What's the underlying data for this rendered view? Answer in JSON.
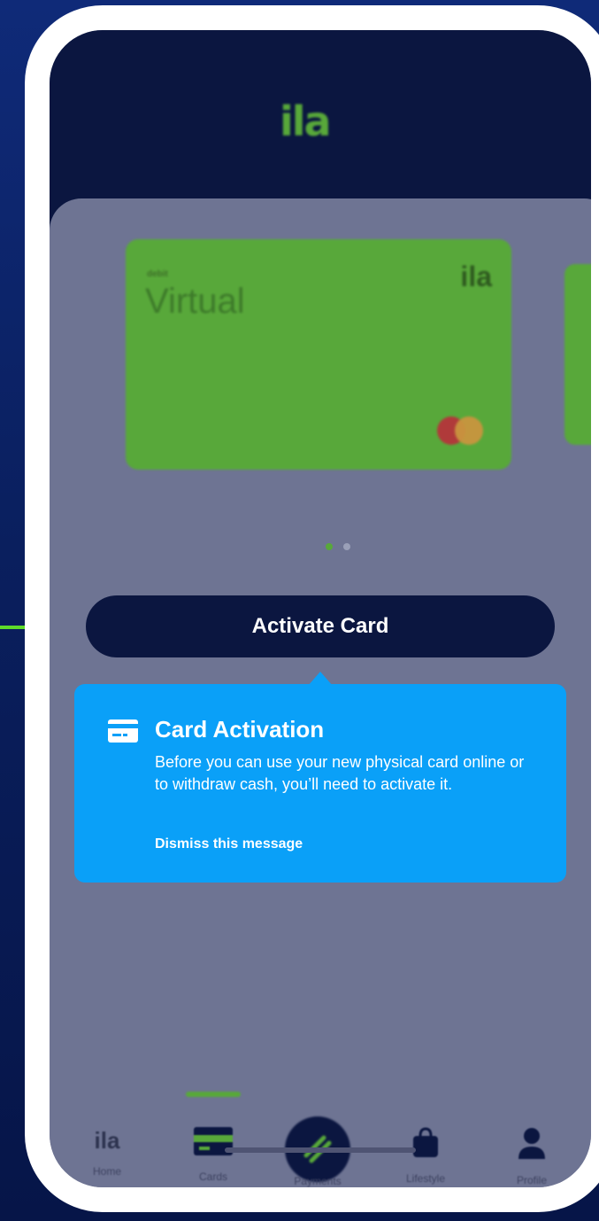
{
  "app": {
    "logo_text": "ila"
  },
  "cards": {
    "primary": {
      "small_label": "debit",
      "title": "Virtual",
      "logo_text": "ila"
    },
    "pagination": {
      "count": 2,
      "active": 1
    }
  },
  "actions": {
    "activate_label": "Activate Card"
  },
  "tooltip": {
    "title": "Card Activation",
    "body": "Before you can use your new physical card online or to withdraw cash, you’ll need to activate it.",
    "dismiss_label": "Dismiss this message"
  },
  "nav": {
    "items": [
      {
        "label": "Home",
        "icon": "ila-logo-icon"
      },
      {
        "label": "Cards",
        "icon": "card-icon"
      },
      {
        "label": "Payments",
        "icon": "payments-icon"
      },
      {
        "label": "Lifestyle",
        "icon": "bag-icon"
      },
      {
        "label": "Profile",
        "icon": "person-icon"
      }
    ],
    "active_index": 1
  },
  "colors": {
    "brand_green": "#58a83a",
    "navy": "#0b1640",
    "tooltip_blue": "#0aa0f8"
  }
}
